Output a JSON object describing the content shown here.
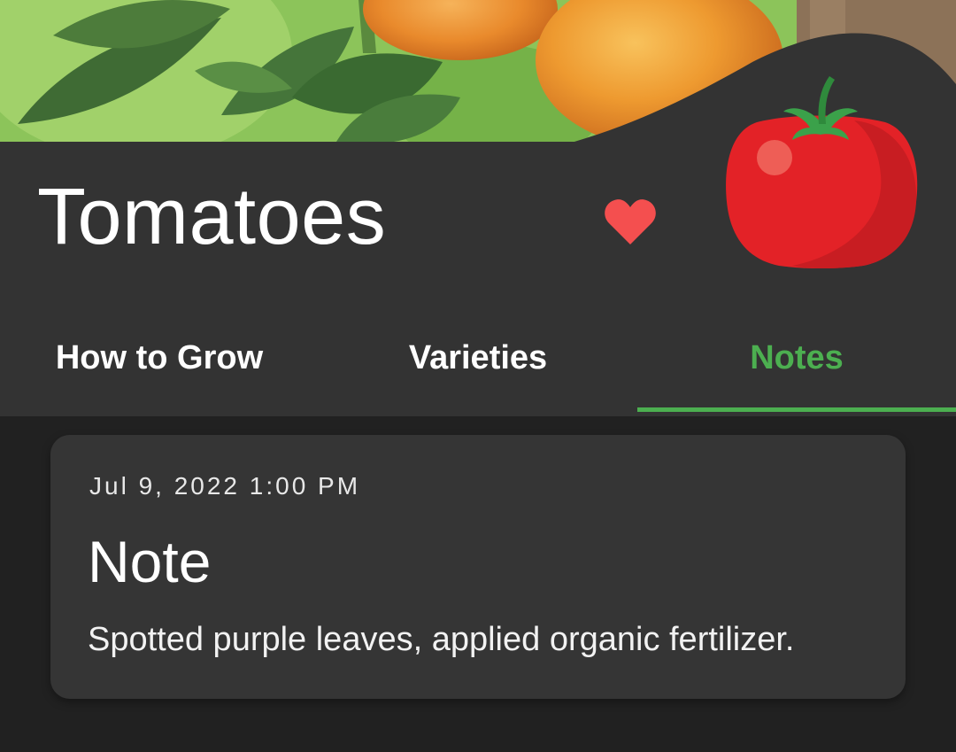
{
  "header": {
    "title": "Tomatoes",
    "favorite": true
  },
  "icons": {
    "favorite": "heart-icon",
    "crop": "tomato-icon"
  },
  "tabs": [
    {
      "label": "How to Grow",
      "active": false
    },
    {
      "label": "Varieties",
      "active": false
    },
    {
      "label": "Notes",
      "active": true
    }
  ],
  "notes": [
    {
      "date": "Jul 9, 2022 1:00 PM",
      "title": "Note",
      "body": "Spotted purple leaves, applied organic fertilizer."
    }
  ],
  "colors": {
    "background": "#212121",
    "surface": "#333333",
    "card": "#353535",
    "accent": "#4caf50",
    "heart": "#f44f4f",
    "tomato": "#e32227"
  }
}
